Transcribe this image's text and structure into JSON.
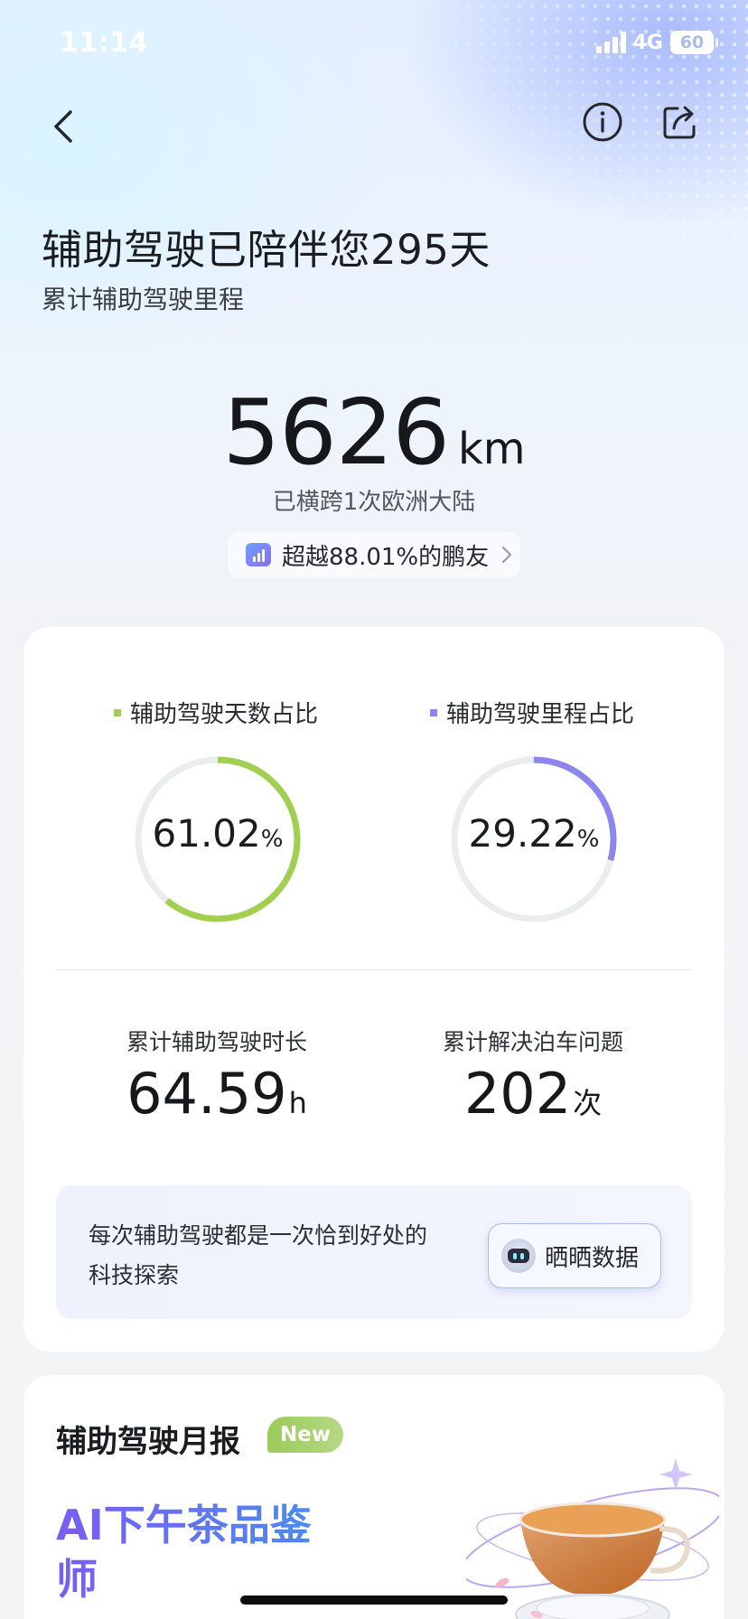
{
  "status_bar": {
    "time": "11:14",
    "network": "4G",
    "battery": "60"
  },
  "nav": {
    "back_icon": "chevron-left-icon",
    "info_icon": "info-icon",
    "share_icon": "share-icon"
  },
  "hero": {
    "title": "辅助驾驶已陪伴您295天",
    "subtitle": "累计辅助驾驶里程",
    "distance_value": "5626",
    "distance_unit": "km",
    "note": "已横跨1次欧洲大陆",
    "rank_text": "超越88.01%的鹏友"
  },
  "ratios": [
    {
      "label": "辅助驾驶天数占比",
      "value": "61.02",
      "unit": "%",
      "fraction": 0.6102,
      "color": "#a2cf4f"
    },
    {
      "label": "辅助驾驶里程占比",
      "value": "29.22",
      "unit": "%",
      "fraction": 0.2922,
      "color": "#8d86ee"
    }
  ],
  "stats": [
    {
      "label": "累计辅助驾驶时长",
      "value": "64.59",
      "unit": "h"
    },
    {
      "label": "累计解决泊车问题",
      "value": "202",
      "unit": "次"
    }
  ],
  "promo": {
    "text": "每次辅助驾驶都是一次恰到好处的科技探索",
    "button_label": "晒晒数据"
  },
  "monthly_report": {
    "title": "辅助驾驶月报",
    "badge": "New",
    "headline": "AI下午茶品鉴师"
  }
}
